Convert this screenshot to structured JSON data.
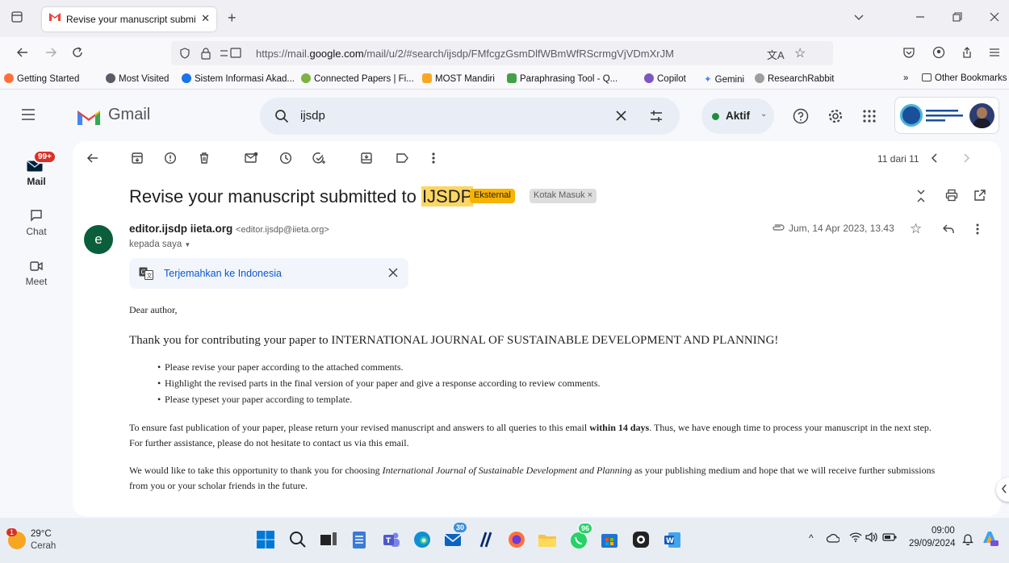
{
  "browser": {
    "tab_title": "Revise your manuscript submitt",
    "tab_close": "✕",
    "new_tab": "+",
    "url_prefix": "https://mail.",
    "url_domain": "google.com",
    "url_rest": "/mail/u/2/#search/ijsdp/FMfcgzGsmDlfWBmWfRScrmgVjVDmXrJM",
    "other_bookmarks": "Other Bookmarks",
    "bookmarks": [
      {
        "label": "Getting Started",
        "color": "#ff7139"
      },
      {
        "label": "Most Visited",
        "color": "#5b5b66"
      },
      {
        "label": "Sistem Informasi Akad...",
        "color": "#1a73e8"
      },
      {
        "label": "Connected Papers | Fi...",
        "color": "#7cb342"
      },
      {
        "label": "MOST Mandiri",
        "color": "#f9a825"
      },
      {
        "label": "Paraphrasing Tool - Q...",
        "color": "#43a047"
      },
      {
        "label": "Copilot",
        "color": "#7e57c2"
      },
      {
        "label": "Gemini",
        "color": "#4285f4"
      },
      {
        "label": "ResearchRabbit",
        "color": "#9e9e9e"
      }
    ]
  },
  "gmail": {
    "brand": "Gmail",
    "search_query": "ijsdp",
    "status": "Aktif",
    "rail": [
      {
        "label": "Mail",
        "badge": "99+"
      },
      {
        "label": "Chat"
      },
      {
        "label": "Meet"
      }
    ],
    "pagination": "11 dari 11",
    "subject_pre": "Revise your manuscript submitted to ",
    "subject_highlight": "IJSDP",
    "label_ext": "Eksternal",
    "label_inbox": "Kotak Masuk",
    "label_remove": "×",
    "avatar_letter": "e",
    "sender_name": "editor.ijsdp iieta.org",
    "sender_email": "<editor.ijsdp@iieta.org>",
    "to_me": "kepada saya",
    "date": "Jum, 14 Apr 2023, 13.43",
    "translate": "Terjemahkan ke Indonesia",
    "body": {
      "greeting": "Dear author,",
      "thanks": "Thank you for contributing your paper to INTERNATIONAL JOURNAL OF SUSTAINABLE DEVELOPMENT AND PLANNING!",
      "bullets": [
        "Please revise your paper according to the attached comments.",
        "Highlight the revised parts in the final version of your paper and give a response according to review comments.",
        "Please typeset your paper according to template."
      ],
      "para1_a": "To ensure fast publication of your paper, please return your revised manuscript and answers to all queries to this email ",
      "para1_bold": "within 14 days",
      "para1_b": ". Thus, we have enough time to process your manuscript in the next step.",
      "para1_c": "For further assistance, please do not hesitate to contact us via this email.",
      "para2_a": "We would like to take this opportunity to thank you for choosing ",
      "para2_italic": "International Journal of Sustainable Development and Planning",
      "para2_b": " as your publishing medium and hope that we will receive further submissions",
      "para2_c": "from you or your scholar friends in the future."
    }
  },
  "taskbar": {
    "weather_temp": "29°C",
    "weather_desc": "Cerah",
    "weather_badge": "1",
    "time": "09:00",
    "date": "29/09/2024",
    "badge_edge": "30",
    "badge_whatsapp": "96"
  },
  "colors": {
    "gmail_red": "#ea4335",
    "highlight": "#fcd663",
    "label_ext_bg": "#f8b300",
    "label_inbox_bg": "#dddddd",
    "avatar_bg": "#0b5e3b",
    "link_blue": "#0b57d0"
  }
}
